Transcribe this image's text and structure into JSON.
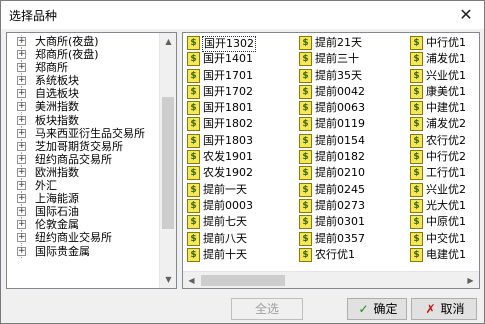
{
  "dialog": {
    "title": "选择品种",
    "close_glyph": "✕"
  },
  "tree": {
    "items": [
      "大商所(夜盘)",
      "郑商所(夜盘)",
      "郑商所",
      "系统板块",
      "自选板块",
      "美洲指数",
      "板块指数",
      "马来西亚衍生品交易所",
      "芝加哥期货交易所",
      "纽约商品交易所",
      "欧洲指数",
      "外汇",
      "上海能源",
      "国际石油",
      "伦敦金属",
      "纽约商业交易所",
      "国际贵金属"
    ]
  },
  "list": {
    "icon_glyph": "$",
    "selected": "国开1302",
    "columns": [
      [
        "国开1302",
        "国开1401",
        "国开1701",
        "国开1702",
        "国开1801",
        "国开1802",
        "国开1803",
        "农发1901",
        "农发1902",
        "提前一天",
        "提前0003",
        "提前七天",
        "提前八天",
        "提前十天"
      ],
      [
        "提前21天",
        "提前三十",
        "提前35天",
        "提前0042",
        "提前0063",
        "提前0119",
        "提前0154",
        "提前0182",
        "提前0210",
        "提前0245",
        "提前0273",
        "提前0301",
        "提前0357",
        "农行优1"
      ],
      [
        "中行优1",
        "浦发优1",
        "兴业优1",
        "康美优1",
        "中建优1",
        "浦发优2",
        "农行优2",
        "中行优2",
        "工行优1",
        "兴业优2",
        "光大优1",
        "中原优1",
        "中交优1",
        "电建优1"
      ]
    ]
  },
  "buttons": {
    "select_all": "全选",
    "ok": "确定",
    "cancel": "取消",
    "ok_icon": "✓",
    "cancel_icon": "✗"
  }
}
